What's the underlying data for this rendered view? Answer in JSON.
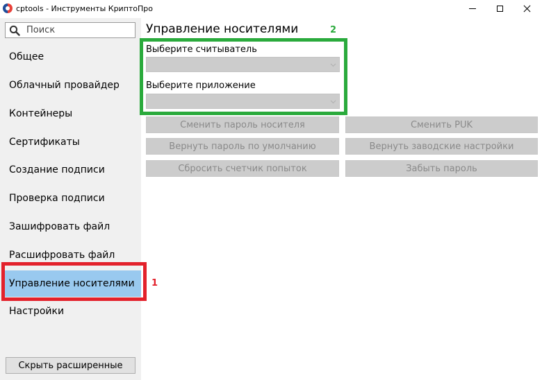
{
  "window": {
    "title": "cptools - Инструменты КриптоПро"
  },
  "sidebar": {
    "search_placeholder": "Поиск",
    "items": [
      {
        "label": "Общее"
      },
      {
        "label": "Облачный провайдер"
      },
      {
        "label": "Контейнеры"
      },
      {
        "label": "Сертификаты"
      },
      {
        "label": "Создание подписи"
      },
      {
        "label": "Проверка подписи"
      },
      {
        "label": "Зашифровать файл"
      },
      {
        "label": "Расшифровать файл"
      },
      {
        "label": "Управление носителями",
        "selected": true
      },
      {
        "label": "Настройки"
      }
    ],
    "hide_advanced_label": "Скрыть расширенные"
  },
  "main": {
    "title": "Управление носителями",
    "reader_label": "Выберите считыватель",
    "reader_value": "",
    "app_label": "Выберите приложение",
    "app_value": "",
    "buttons": {
      "change_password": "Сменить пароль носителя",
      "change_puk": "Сменить PUK",
      "reset_password_default": "Вернуть пароль по умолчанию",
      "factory_reset": "Вернуть заводские настройки",
      "reset_attempts": "Сбросить счетчик попыток",
      "forget_password": "Забыть пароль"
    }
  },
  "annotations": {
    "red_label": "1",
    "green_label": "2",
    "red_color": "#e3212b",
    "green_color": "#2aaa3c"
  },
  "colors": {
    "selected_item": "#99c9ef",
    "sidebar_bg": "#f0f0f0",
    "disabled_control": "#cccccc",
    "disabled_text": "#8a8a8a"
  }
}
